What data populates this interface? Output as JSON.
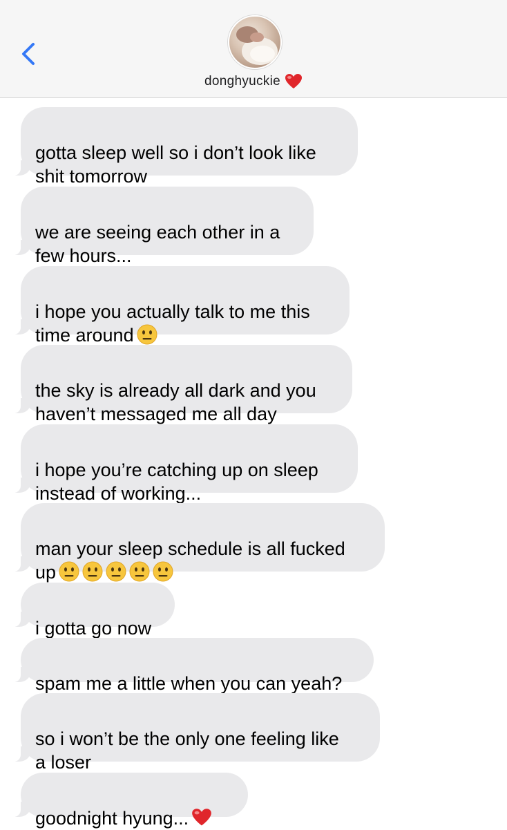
{
  "header": {
    "contact_name": "donghyuckie",
    "back_icon": "chevron-left-icon",
    "name_emoji": "red-heart-icon",
    "avatar": "contact-avatar"
  },
  "colors": {
    "accent": "#3478f6",
    "incoming_bubble": "#e9e9eb",
    "header_bg": "#f6f6f6"
  },
  "messages": [
    {
      "text": "gotta sleep well so i don’t look like\nshit tomorrow",
      "emojis": []
    },
    {
      "text": "we are seeing each other in a\nfew hours...",
      "emojis": []
    },
    {
      "text": "i hope you actually talk to me this\ntime around",
      "emojis": [
        "neutral-face-icon"
      ]
    },
    {
      "text": "the sky is already all dark and you\nhaven’t messaged me all day",
      "emojis": []
    },
    {
      "text": "i hope you’re catching up on sleep\ninstead of working...",
      "emojis": []
    },
    {
      "text": "man your sleep schedule is all fucked\nup",
      "emojis": [
        "neutral-face-icon",
        "neutral-face-icon",
        "neutral-face-icon",
        "neutral-face-icon",
        "neutral-face-icon"
      ]
    },
    {
      "text": "i gotta go now",
      "emojis": []
    },
    {
      "text": "spam me a little when you can yeah?",
      "emojis": []
    },
    {
      "text": "so i won’t be the only one feeling like\na loser",
      "emojis": []
    },
    {
      "text": "goodnight hyung...",
      "emojis": [
        "red-heart-icon"
      ]
    }
  ]
}
